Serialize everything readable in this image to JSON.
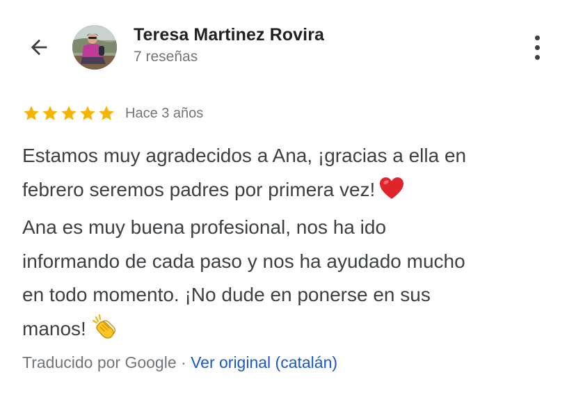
{
  "reviewer": {
    "name": "Teresa Martinez Rovira",
    "reviews_count": "7 reseñas"
  },
  "review": {
    "rating": 5,
    "max_rating": 5,
    "time_ago": "Hace 3 años",
    "paragraph1_line1": "Estamos muy agradecidos a Ana, ¡gracias a ella en",
    "paragraph1_line2": "febrero seremos padres por primera vez!",
    "paragraph1_emoji": "red-heart",
    "paragraph2_line1": "Ana es muy buena profesional, nos ha ido",
    "paragraph2_line2": "informando de cada paso y nos ha ayudado mucho",
    "paragraph2_line3": "en todo momento. ¡No dude en ponerse en sus",
    "paragraph2_line4": "manos!",
    "paragraph2_emoji": "clapping-hands"
  },
  "translation": {
    "note": "Traducido por Google",
    "separator": "·",
    "original_link": "Ver original (catalán)"
  },
  "icons": {
    "back": "back-arrow-icon",
    "more": "more-vert-icon",
    "star": "star-icon"
  },
  "colors": {
    "star": "#f4b400",
    "link": "#1a57c5",
    "secondary_text": "#70757a",
    "primary_text": "#3c4043"
  }
}
